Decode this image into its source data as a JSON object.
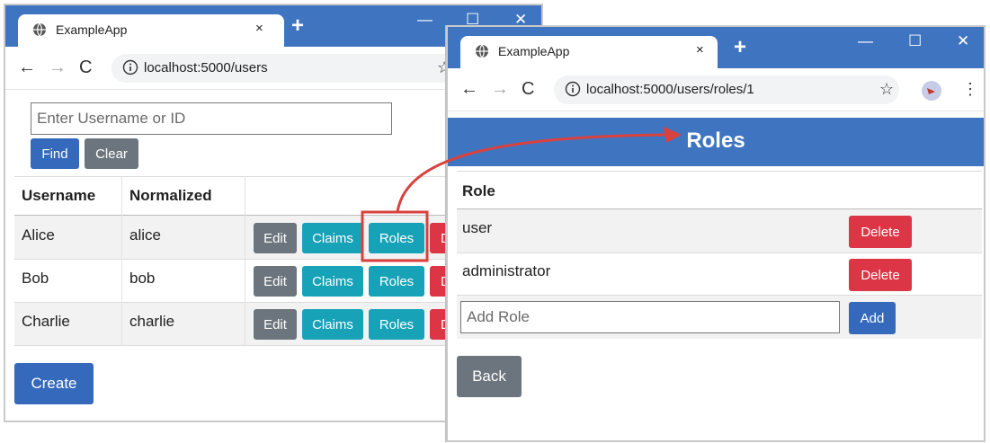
{
  "colors": {
    "accent": "#3f75c0",
    "primary": "#3569bc",
    "secondary": "#6c757d",
    "info": "#17a2b8",
    "danger": "#dc3545",
    "highlight": "#d9413e"
  },
  "window1": {
    "tab_title": "ExampleApp",
    "tab_close": "×",
    "new_tab": "+",
    "url": "localhost:5000/users",
    "search": {
      "placeholder": "Enter Username or ID",
      "value": ""
    },
    "find_label": "Find",
    "clear_label": "Clear",
    "table": {
      "headers": [
        "Username",
        "Normalized",
        ""
      ],
      "rows": [
        {
          "username": "Alice",
          "normalized": "alice"
        },
        {
          "username": "Bob",
          "normalized": "bob"
        },
        {
          "username": "Charlie",
          "normalized": "charlie"
        }
      ],
      "edit_label": "Edit",
      "claims_label": "Claims",
      "roles_label": "Roles",
      "delete_label": "D"
    },
    "create_label": "Create"
  },
  "window2": {
    "tab_title": "ExampleApp",
    "tab_close": "×",
    "new_tab": "+",
    "url": "localhost:5000/users/roles/1",
    "page_title": "Roles",
    "table_header": "Role",
    "roles": [
      {
        "name": "user",
        "action": "Delete"
      },
      {
        "name": "administrator",
        "action": "Delete"
      }
    ],
    "add_role": {
      "placeholder": "Add Role",
      "value": ""
    },
    "add_label": "Add",
    "back_label": "Back"
  },
  "icons": [
    "globe-icon",
    "close-icon",
    "new-tab-icon",
    "minimize-icon",
    "maximize-icon",
    "window-close-icon",
    "back-arrow-icon",
    "forward-arrow-icon",
    "reload-icon",
    "info-icon",
    "star-icon",
    "profile-avatar",
    "menu-dots-icon",
    "callout-arrow"
  ]
}
